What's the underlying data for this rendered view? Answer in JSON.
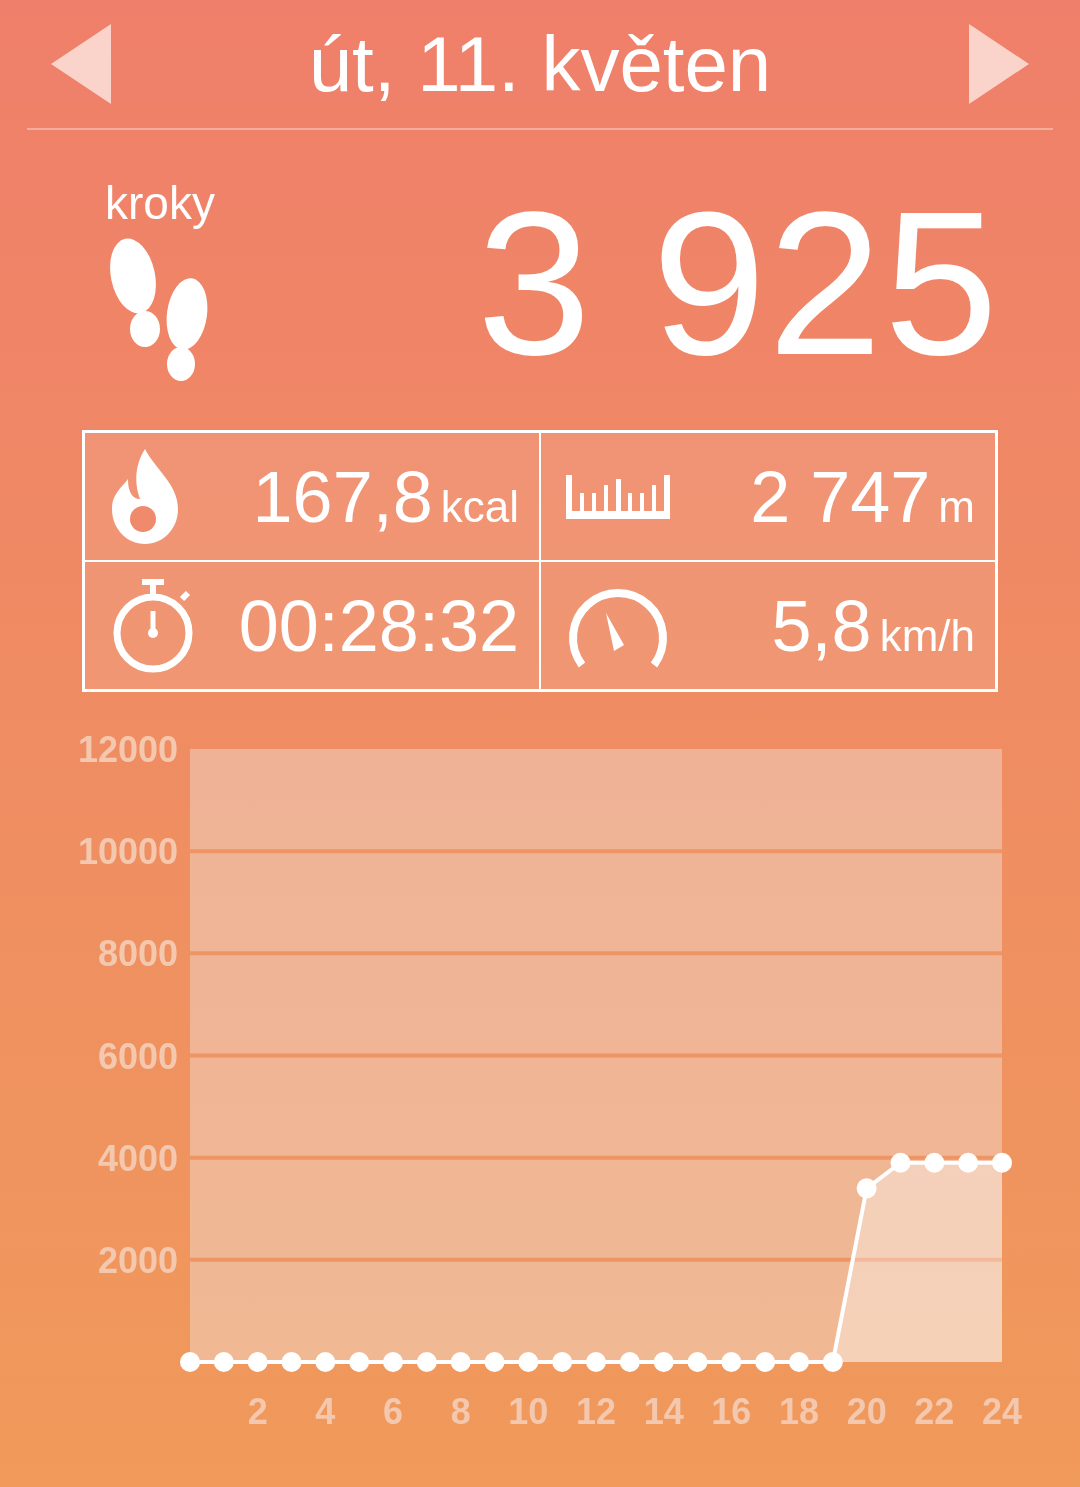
{
  "header": {
    "title": "út, 11. květen"
  },
  "steps": {
    "label": "kroky",
    "value": "3 925"
  },
  "stats": [
    {
      "kind": "calories",
      "value": "167,8",
      "unit": "kcal"
    },
    {
      "kind": "distance",
      "value": "2 747",
      "unit": "m"
    },
    {
      "kind": "duration",
      "value": "00:28:32"
    },
    {
      "kind": "speed",
      "value": "5,8",
      "unit": "km/h"
    }
  ],
  "chart": {
    "chart_data": {
      "type": "area",
      "x": [
        0,
        1,
        2,
        3,
        4,
        5,
        6,
        7,
        8,
        9,
        10,
        11,
        12,
        13,
        14,
        15,
        16,
        17,
        18,
        19,
        20,
        21,
        22,
        23,
        24
      ],
      "series": [
        {
          "color": "#ffffff",
          "values": [
            0,
            0,
            0,
            0,
            0,
            0,
            0,
            0,
            0,
            0,
            0,
            0,
            0,
            0,
            0,
            0,
            0,
            0,
            0,
            0,
            3400,
            3900,
            3900,
            3900,
            3900
          ]
        }
      ],
      "xlim": [
        0,
        24
      ],
      "ylim": [
        0,
        12000
      ],
      "xticks": [
        2,
        4,
        6,
        8,
        10,
        12,
        14,
        16,
        18,
        20,
        22,
        24
      ],
      "yticks": [
        2000,
        4000,
        6000,
        8000,
        10000,
        12000
      ],
      "grid": true
    }
  }
}
